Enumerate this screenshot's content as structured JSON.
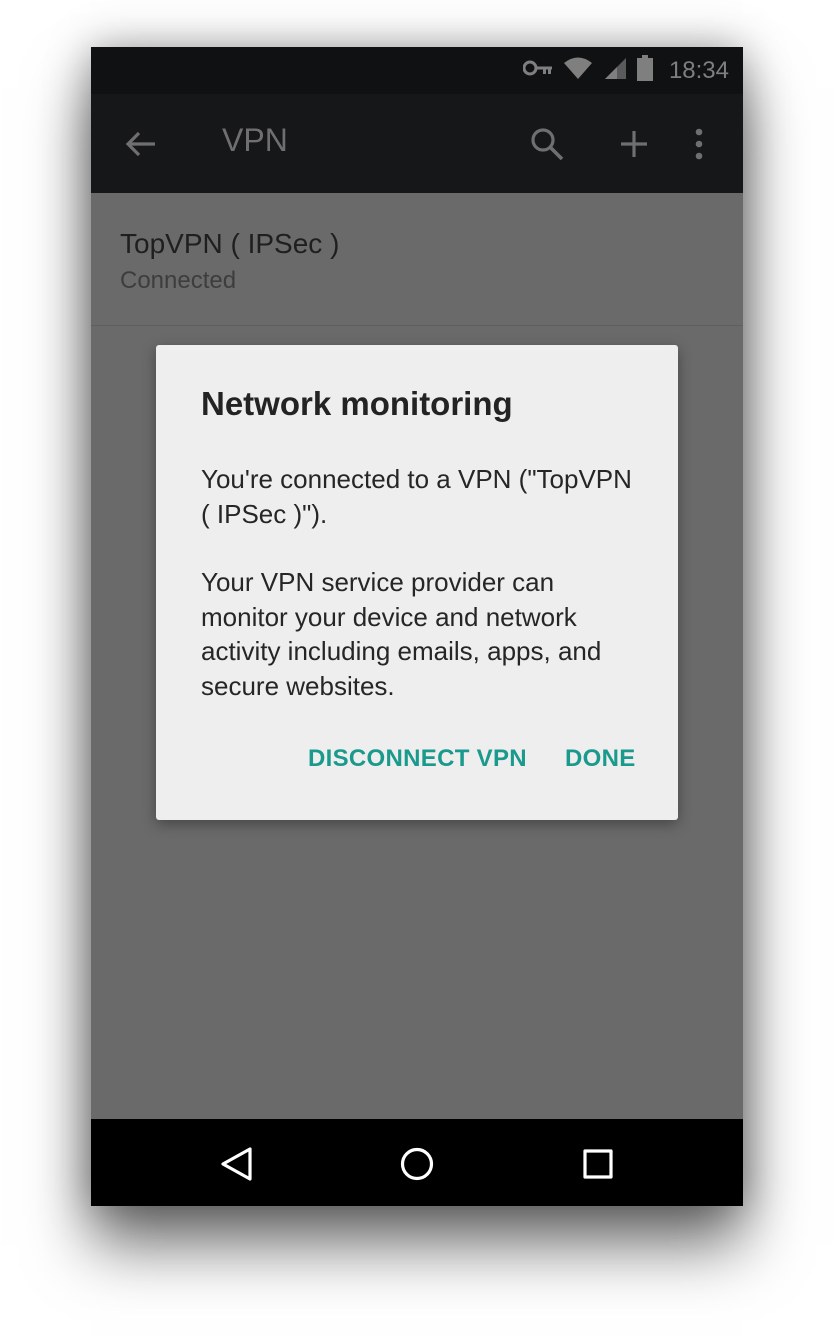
{
  "status_bar": {
    "time": "18:34",
    "icons": [
      "vpn-key-icon",
      "wifi-icon",
      "cellular-signal-icon",
      "battery-icon"
    ]
  },
  "app_bar": {
    "title": "VPN",
    "actions": [
      "back-arrow-icon",
      "search-icon",
      "add-icon",
      "overflow-menu-icon"
    ]
  },
  "vpn_list": [
    {
      "name": "TopVPN ( IPSec )",
      "status": "Connected"
    }
  ],
  "dialog": {
    "title": "Network monitoring",
    "message_1": "You're connected to a VPN (\"TopVPN ( IPSec )\").",
    "message_2": "Your VPN service provider can monitor your device and network activity including emails, apps, and secure websites.",
    "disconnect_label": "DISCONNECT VPN",
    "done_label": "DONE",
    "accent_color": "#1a9a8c"
  },
  "nav_bar": {
    "buttons": [
      "back-triangle-icon",
      "home-circle-icon",
      "recents-square-icon"
    ]
  }
}
